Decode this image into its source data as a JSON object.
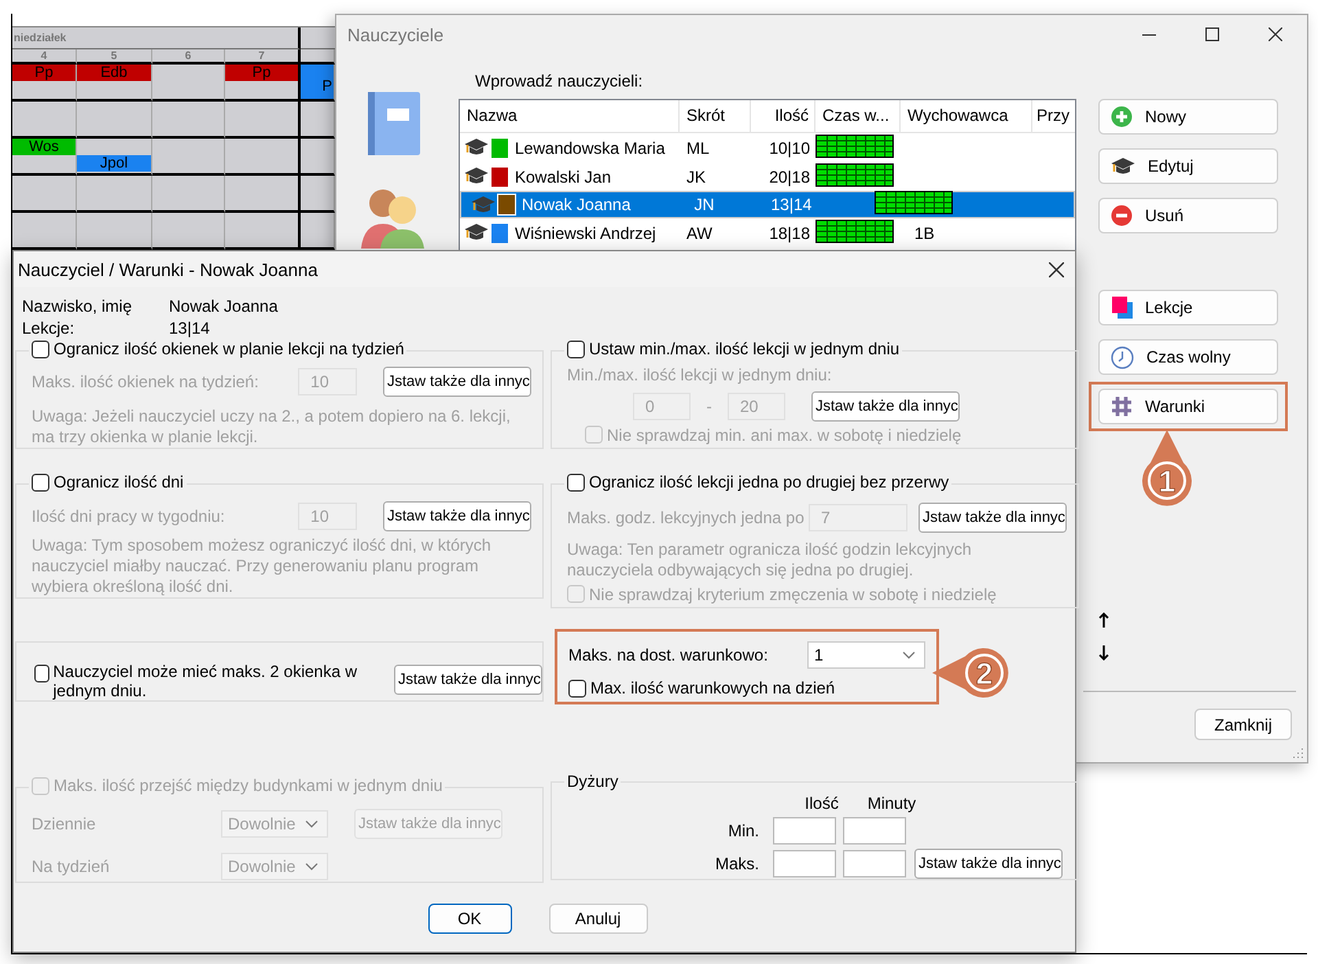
{
  "timetable": {
    "day": "niedziałek",
    "periods": [
      "4",
      "5",
      "6",
      "7"
    ],
    "rows": [
      {
        "cells": [
          {
            "top": {
              "label": "Pp",
              "color": "#c00000"
            }
          },
          {
            "top": {
              "label": "Edb",
              "color": "#c00000"
            }
          },
          {},
          {
            "top": {
              "label": "Pp",
              "color": "#c00000"
            }
          },
          {
            "full": {
              "label": "P",
              "color": "#1a82f0"
            }
          }
        ]
      },
      {
        "cells": [
          {},
          {},
          {},
          {},
          {}
        ]
      },
      {
        "cells": [
          {
            "top": {
              "label": "Wos",
              "color": "#00bb00"
            }
          },
          {
            "bottom": {
              "label": "Jpol",
              "color": "#1a82f0"
            }
          },
          {},
          {},
          {}
        ]
      },
      {
        "cells": [
          {},
          {},
          {},
          {},
          {}
        ]
      },
      {
        "cells": [
          {},
          {},
          {},
          {},
          {}
        ]
      }
    ]
  },
  "teachers_window": {
    "title": "Nauczyciele",
    "list_label": "Wprowadź nauczycieli:",
    "columns": [
      "Nazwa",
      "Skrót",
      "Ilość",
      "Czas w...",
      "Wychowawca",
      "Przy"
    ],
    "rows": [
      {
        "name": "Lewandowska Maria",
        "abbr": "ML",
        "count": "10|10",
        "color": "#00bb00",
        "selected": false
      },
      {
        "name": "Kowalski Jan",
        "abbr": "JK",
        "count": "20|18",
        "color": "#c00000",
        "selected": false
      },
      {
        "name": "Nowak Joanna",
        "abbr": "JN",
        "count": "13|14",
        "color": "#7a4a00",
        "selected": true
      },
      {
        "name": "Wiśniewski Andrzej",
        "abbr": "AW",
        "count": "18|18",
        "color": "#1a82f0",
        "homeroom": "1B",
        "selected": false
      }
    ],
    "buttons": [
      {
        "label": "Nowy",
        "highlighted": false
      },
      {
        "label": "Edytuj",
        "highlighted": false
      },
      {
        "label": "Usuń",
        "highlighted": false
      },
      {
        "label": "Lekcje",
        "highlighted": false
      },
      {
        "label": "Czas wolny",
        "highlighted": false
      },
      {
        "label": "Warunki",
        "highlighted": true
      }
    ],
    "close_button": "Zamknij"
  },
  "conditions_dialog": {
    "title": "Nauczyciel / Warunki - Nowak Joanna",
    "info": [
      {
        "label": "Nazwisko, imię",
        "value": "Nowak Joanna"
      },
      {
        "label": "Lekcje:",
        "value": "13|14"
      }
    ],
    "left_groups": [
      {
        "kind": "single",
        "checkbox": {
          "label": "Ogranicz ilość okienek w planie lekcji na tydzień",
          "checked": false,
          "disabled": false
        },
        "field_label": "Maks. ilość okienek na tydzień:",
        "value": "10",
        "content_disabled": true,
        "button": {
          "label": "Jstaw także dla innyc",
          "disabled": false
        },
        "note": "Uwaga: Jeżeli nauczyciel uczy na 2., a potem dopiero na 6. lekcji, ma trzy okienka w planie lekcji."
      },
      {
        "kind": "single",
        "checkbox": {
          "label": "Ogranicz ilość dni",
          "checked": false,
          "disabled": false
        },
        "field_label": "Ilość dni pracy w tygodniu:",
        "value": "10",
        "content_disabled": true,
        "button": {
          "label": "Jstaw także dla innyc",
          "disabled": false
        },
        "note": "Uwaga: Tym sposobem możesz ograniczyć ilość dni, w których nauczyciel miałby nauczać. Przy generowaniu planu program wybiera określoną ilość dni."
      },
      {
        "kind": "inline",
        "checkbox": {
          "label": "Nauczyciel może mieć maks. 2 okienka w jednym dniu.",
          "checked": false,
          "disabled": false
        },
        "button": {
          "label": "Jstaw także dla innyc",
          "disabled": false
        }
      },
      {
        "kind": "dropdowns",
        "checkbox": {
          "label": "Maks. ilość przejść między budynkami w jednym dniu",
          "checked": false,
          "disabled": true
        },
        "content_disabled": true,
        "selects": [
          {
            "label": "Dziennie",
            "value": "Dowolnie"
          },
          {
            "label": "Na tydzień",
            "value": "Dowolnie"
          }
        ],
        "button": {
          "label": "Jstaw także dla innyc",
          "disabled": true
        }
      }
    ],
    "right_groups": [
      {
        "kind": "range",
        "checkbox": {
          "label": "Ustaw min./max. ilość lekcji w jednym dniu",
          "checked": false,
          "disabled": false
        },
        "field_label": "Min./max. ilość lekcji w jednym dniu:",
        "min": "0",
        "separator": "-",
        "max": "20",
        "content_disabled": true,
        "button": {
          "label": "Jstaw także dla innyc",
          "disabled": false
        },
        "sub_checkbox": {
          "label": "Nie sprawdzaj min. ani max. w sobotę i niedzielę",
          "checked": false,
          "disabled": true
        }
      },
      {
        "kind": "single",
        "checkbox": {
          "label": "Ogranicz ilość lekcji jedna po drugiej bez przerwy",
          "checked": false,
          "disabled": false
        },
        "field_label": "Maks. godz. lekcyjnych jedna po",
        "value": "7",
        "content_disabled": true,
        "button": {
          "label": "Jstaw także dla innyc",
          "disabled": false
        },
        "note": "Uwaga: Ten parametr ogranicza ilość godzin lekcyjnych nauczyciela odbywających się jedna po drugiej.",
        "sub_checkbox": {
          "label": "Nie sprawdzaj kryterium zmęczenia w sobotę i niedzielę",
          "checked": false,
          "disabled": true
        }
      },
      {
        "kind": "conditional",
        "highlighted": true,
        "select_label": "Maks. na dost. warunkowo:",
        "value": "1",
        "checkbox": {
          "label": "Max. ilość warunkowych na dzień",
          "checked": false,
          "disabled": false
        }
      },
      {
        "kind": "duty",
        "title": "Dyżury",
        "columns": [
          "Ilość",
          "Minuty"
        ],
        "rows": [
          {
            "label": "Min."
          },
          {
            "label": "Maks."
          }
        ],
        "button": {
          "label": "Jstaw także dla innyc",
          "disabled": false
        }
      }
    ],
    "ok_button": "OK",
    "cancel_button": "Anuluj"
  },
  "callouts": [
    {
      "number": "1"
    },
    {
      "number": "2"
    }
  ]
}
